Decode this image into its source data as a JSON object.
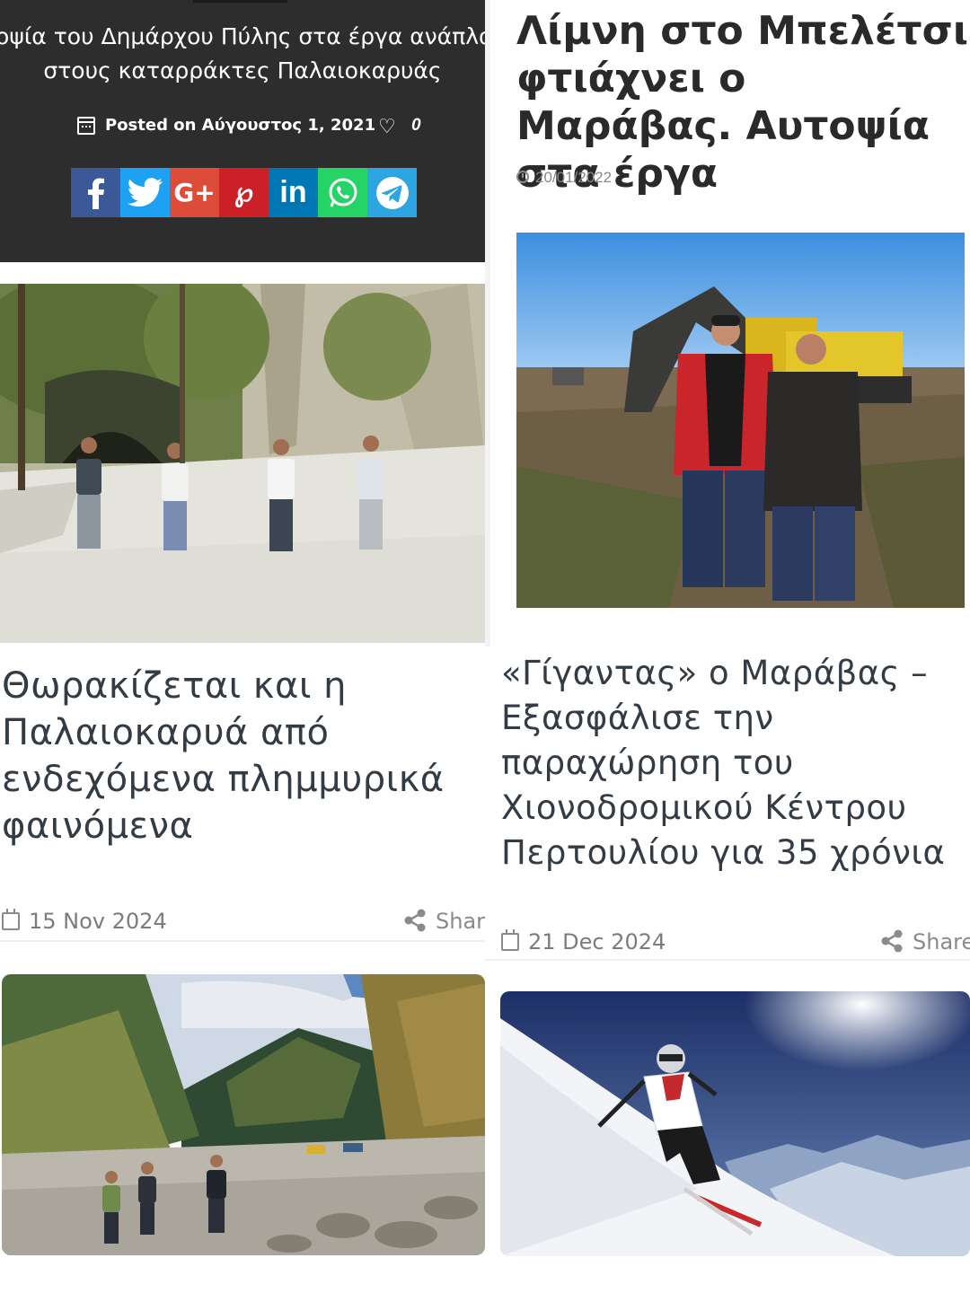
{
  "top_left": {
    "title_line1": "τοψία του Δημάρχου Πύλης στα έργα ανάπλασ",
    "title_line2": "στους καταρράκτες Παλαιοκαρυάς",
    "posted": "Posted on Αύγουστος 1, 2021",
    "likes": "0",
    "share_buttons": [
      {
        "name": "facebook",
        "icon": "facebook-icon",
        "color": "#3b5998"
      },
      {
        "name": "twitter",
        "icon": "twitter-icon",
        "color": "#1da1f2"
      },
      {
        "name": "google-plus",
        "icon": "google-plus-icon",
        "color": "#dd4b39"
      },
      {
        "name": "pinterest",
        "icon": "pinterest-icon",
        "color": "#cb2027"
      },
      {
        "name": "linkedin",
        "icon": "linkedin-icon",
        "color": "#0077b5"
      },
      {
        "name": "whatsapp",
        "icon": "whatsapp-icon",
        "color": "#25d366"
      },
      {
        "name": "telegram",
        "icon": "telegram-icon",
        "color": "#2ca5e0"
      }
    ]
  },
  "top_right": {
    "title": "Λίμνη στο Μπελέτσι φτιάχνει ο Μαράβας. Αυτοψία στα έργα",
    "date": "20/01/2022"
  },
  "cards": [
    {
      "title": "Θωρακίζεται και η Παλαιοκαρυά από ενδεχόμενα πλημμυρικά φαινόμενα",
      "date": "15 Nov 2024",
      "share": "Shar"
    },
    {
      "title": "«Γίγαντας» ο Μαράβας – Εξασφάλισε την παραχώρηση του Χιονοδρομικού Κέντρου Περτουλίου για 35 χρόνια",
      "date": "21 Dec 2024",
      "share": "Share"
    }
  ],
  "colors": {
    "dark_panel": "#2d2d2d",
    "headline": "#2a2a2a",
    "card_title": "#333b44",
    "meta_gray": "#7c7c7c"
  }
}
